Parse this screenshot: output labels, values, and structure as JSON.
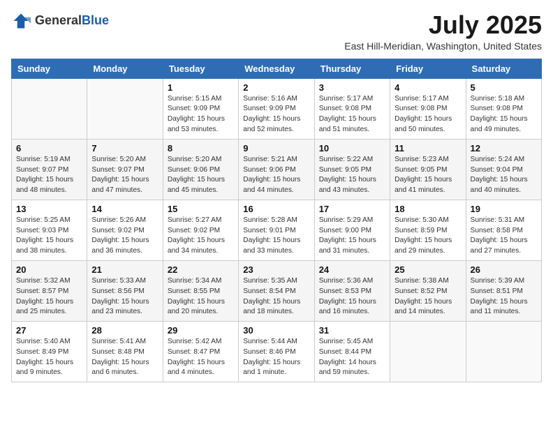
{
  "logo": {
    "general": "General",
    "blue": "Blue"
  },
  "title": "July 2025",
  "location": "East Hill-Meridian, Washington, United States",
  "days_of_week": [
    "Sunday",
    "Monday",
    "Tuesday",
    "Wednesday",
    "Thursday",
    "Friday",
    "Saturday"
  ],
  "weeks": [
    [
      {
        "day": "",
        "info": ""
      },
      {
        "day": "",
        "info": ""
      },
      {
        "day": "1",
        "info": "Sunrise: 5:15 AM\nSunset: 9:09 PM\nDaylight: 15 hours\nand 53 minutes."
      },
      {
        "day": "2",
        "info": "Sunrise: 5:16 AM\nSunset: 9:09 PM\nDaylight: 15 hours\nand 52 minutes."
      },
      {
        "day": "3",
        "info": "Sunrise: 5:17 AM\nSunset: 9:08 PM\nDaylight: 15 hours\nand 51 minutes."
      },
      {
        "day": "4",
        "info": "Sunrise: 5:17 AM\nSunset: 9:08 PM\nDaylight: 15 hours\nand 50 minutes."
      },
      {
        "day": "5",
        "info": "Sunrise: 5:18 AM\nSunset: 9:08 PM\nDaylight: 15 hours\nand 49 minutes."
      }
    ],
    [
      {
        "day": "6",
        "info": "Sunrise: 5:19 AM\nSunset: 9:07 PM\nDaylight: 15 hours\nand 48 minutes."
      },
      {
        "day": "7",
        "info": "Sunrise: 5:20 AM\nSunset: 9:07 PM\nDaylight: 15 hours\nand 47 minutes."
      },
      {
        "day": "8",
        "info": "Sunrise: 5:20 AM\nSunset: 9:06 PM\nDaylight: 15 hours\nand 45 minutes."
      },
      {
        "day": "9",
        "info": "Sunrise: 5:21 AM\nSunset: 9:06 PM\nDaylight: 15 hours\nand 44 minutes."
      },
      {
        "day": "10",
        "info": "Sunrise: 5:22 AM\nSunset: 9:05 PM\nDaylight: 15 hours\nand 43 minutes."
      },
      {
        "day": "11",
        "info": "Sunrise: 5:23 AM\nSunset: 9:05 PM\nDaylight: 15 hours\nand 41 minutes."
      },
      {
        "day": "12",
        "info": "Sunrise: 5:24 AM\nSunset: 9:04 PM\nDaylight: 15 hours\nand 40 minutes."
      }
    ],
    [
      {
        "day": "13",
        "info": "Sunrise: 5:25 AM\nSunset: 9:03 PM\nDaylight: 15 hours\nand 38 minutes."
      },
      {
        "day": "14",
        "info": "Sunrise: 5:26 AM\nSunset: 9:02 PM\nDaylight: 15 hours\nand 36 minutes."
      },
      {
        "day": "15",
        "info": "Sunrise: 5:27 AM\nSunset: 9:02 PM\nDaylight: 15 hours\nand 34 minutes."
      },
      {
        "day": "16",
        "info": "Sunrise: 5:28 AM\nSunset: 9:01 PM\nDaylight: 15 hours\nand 33 minutes."
      },
      {
        "day": "17",
        "info": "Sunrise: 5:29 AM\nSunset: 9:00 PM\nDaylight: 15 hours\nand 31 minutes."
      },
      {
        "day": "18",
        "info": "Sunrise: 5:30 AM\nSunset: 8:59 PM\nDaylight: 15 hours\nand 29 minutes."
      },
      {
        "day": "19",
        "info": "Sunrise: 5:31 AM\nSunset: 8:58 PM\nDaylight: 15 hours\nand 27 minutes."
      }
    ],
    [
      {
        "day": "20",
        "info": "Sunrise: 5:32 AM\nSunset: 8:57 PM\nDaylight: 15 hours\nand 25 minutes."
      },
      {
        "day": "21",
        "info": "Sunrise: 5:33 AM\nSunset: 8:56 PM\nDaylight: 15 hours\nand 23 minutes."
      },
      {
        "day": "22",
        "info": "Sunrise: 5:34 AM\nSunset: 8:55 PM\nDaylight: 15 hours\nand 20 minutes."
      },
      {
        "day": "23",
        "info": "Sunrise: 5:35 AM\nSunset: 8:54 PM\nDaylight: 15 hours\nand 18 minutes."
      },
      {
        "day": "24",
        "info": "Sunrise: 5:36 AM\nSunset: 8:53 PM\nDaylight: 15 hours\nand 16 minutes."
      },
      {
        "day": "25",
        "info": "Sunrise: 5:38 AM\nSunset: 8:52 PM\nDaylight: 15 hours\nand 14 minutes."
      },
      {
        "day": "26",
        "info": "Sunrise: 5:39 AM\nSunset: 8:51 PM\nDaylight: 15 hours\nand 11 minutes."
      }
    ],
    [
      {
        "day": "27",
        "info": "Sunrise: 5:40 AM\nSunset: 8:49 PM\nDaylight: 15 hours\nand 9 minutes."
      },
      {
        "day": "28",
        "info": "Sunrise: 5:41 AM\nSunset: 8:48 PM\nDaylight: 15 hours\nand 6 minutes."
      },
      {
        "day": "29",
        "info": "Sunrise: 5:42 AM\nSunset: 8:47 PM\nDaylight: 15 hours\nand 4 minutes."
      },
      {
        "day": "30",
        "info": "Sunrise: 5:44 AM\nSunset: 8:46 PM\nDaylight: 15 hours\nand 1 minute."
      },
      {
        "day": "31",
        "info": "Sunrise: 5:45 AM\nSunset: 8:44 PM\nDaylight: 14 hours\nand 59 minutes."
      },
      {
        "day": "",
        "info": ""
      },
      {
        "day": "",
        "info": ""
      }
    ]
  ]
}
